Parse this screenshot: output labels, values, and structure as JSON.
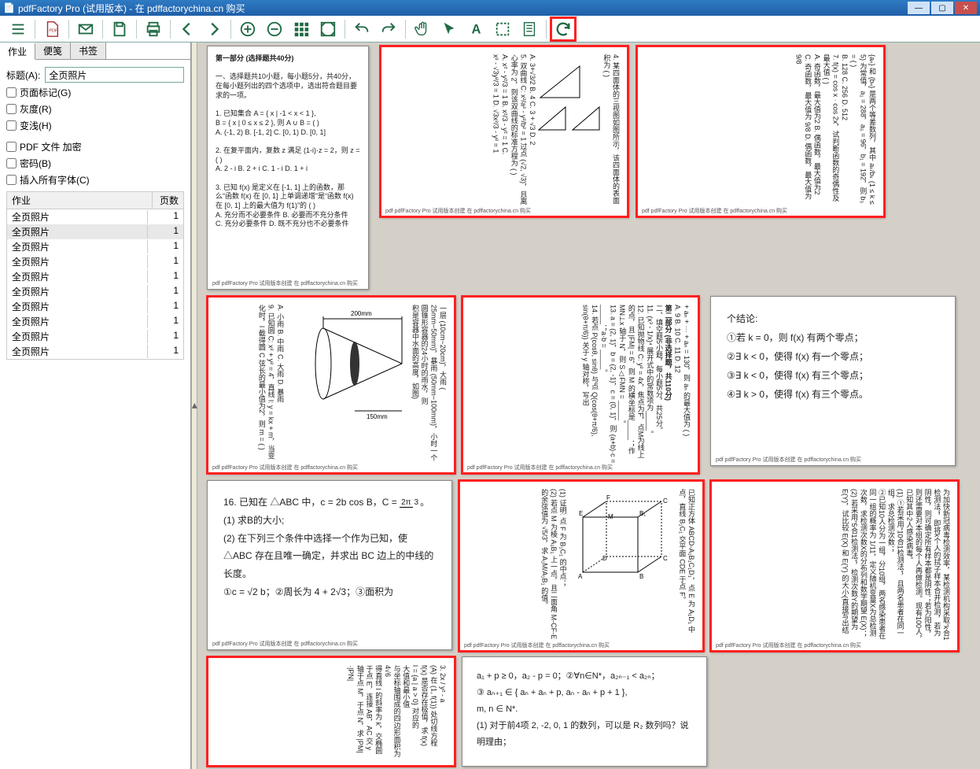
{
  "title": "pdfFactory Pro (试用版本) - 在 pdffactorychina.cn 购买",
  "tabs": {
    "jobs": "作业",
    "notes": "便笺",
    "bookmarks": "书签"
  },
  "sidebar": {
    "title_label": "标题(A):",
    "title_value": "全页照片",
    "opts": {
      "pagemark": "页面标记(G)",
      "gray": "灰度(R)",
      "light": "变浅(H)",
      "encrypt": "PDF 文件 加密",
      "pwd": "密码(B)",
      "embed": "插入所有字体(C)"
    },
    "list_hdr": {
      "name": "作业",
      "pages": "页数"
    },
    "items": [
      {
        "name": "全页照片",
        "pages": "1"
      },
      {
        "name": "全页照片",
        "pages": "1"
      },
      {
        "name": "全页照片",
        "pages": "1"
      },
      {
        "name": "全页照片",
        "pages": "1"
      },
      {
        "name": "全页照片",
        "pages": "1"
      },
      {
        "name": "全页照片",
        "pages": "1"
      },
      {
        "name": "全页照片",
        "pages": "1"
      },
      {
        "name": "全页照片",
        "pages": "1"
      },
      {
        "name": "全页照片",
        "pages": "1"
      },
      {
        "name": "全页照片",
        "pages": "1"
      }
    ]
  },
  "pages": {
    "p1": {
      "t1": "第一部分 (选择题共40分)",
      "t2": "一、选择题共10小题，每小题5分，共40分，在每小题列出的四个选项中，选出符合题目要求的一项。",
      "t3": "1. 已知集合 A = { x | -1 < x < 1 },",
      "t4": "B = { x | 0 ≤ x ≤ 2 }, 则 A ∪ B = (    )",
      "t5": "A. (-1, 2)   B. [-1, 2]   C. [0, 1)   D. [0, 1]",
      "t6": "2. 在复平面内，复数 z 满足 (1-i)·z = 2，则 z = (    )",
      "t7": "A. 2 - i   B. 2 + i   C. 1 - i   D. 1 + i",
      "t8": "3. 已知 f(x) 是定义在 [-1, 1] 上的函数，那么“函数 f(x) 在 [0, 1] 上单调递增”是“函数 f(x) 在 [0, 1] 上的最大值为 f(1)”的 (    )",
      "t9": "A. 充分而不必要条件   B. 必要而不充分条件",
      "t10": "C. 充分必要条件   D. 既不充分也不必要条件"
    },
    "p2": {
      "t1": "4. 某四面体的三视图如图所示，该四面体的表面积为 (    )",
      "t2": "A. 3+√3/2   B. 4   C. 3 + √3   D. 2",
      "t3": "5. 双曲线 C: x²/a² - y²/b² = 1 过点 (√2, √3)，且离心率为 2，则该双曲线的标准方程为 (    )",
      "t4": "A. x² - y²/3 = 1   B. x²/3 - y² = 1   C.",
      "t5": "x² - √3y²/3 = 1   D. √3x²/3 - y² = 1"
    },
    "p3": {
      "t1": "{aₙ} 和 {bₙ} 是两个等差数列，其中 aₖ/bₖ (1 ≤ k ≤ 5) 为常值，a₁ = 288，a₅ = 96，b₁ = 192，则 b₃ = (    )",
      "t2": "B. 128   C. 256   D. 512",
      "t3": "7. f(x) = cos x · cos 2x，试判断函数的奇偶性及最大值 (    )",
      "t4": "A. 奇函数，最大值为2   B. 偶函数，最大值为2",
      "t5": "C. 奇函数，最大值为 9/8   D. 偶函数，最大值为 9/8"
    },
    "p4": {
      "t1": "一层 (10cm~20cm)，大雨 (",
      "t2": "25mm~50mm)，暴雨 (50mm~100mm)，小时一个圆锥形容器的24小时的雨水，则",
      "t3": "积是容器中水面的高度，如图)",
      "t4": "A. 小雨   B. 中雨   C. 大雨   D. 暴雨",
      "t5": "9. 已知圆 C: x² + y² = 4，直线 l: y = kx + m，当变化时，l 截得圆 C 弦长的最小值为2，则 m = (    )"
    },
    "p5": {
      "t1": "+ aₙ + ··· + aₙ = 130，则 aₙ 的最大值为 (    )",
      "t2": "A. 9   B. 10   C. 11   D. 12",
      "t3": "第二部分 (非选择题，共110分)",
      "t4": "二、填空题5小题，每小题5分，共25分。",
      "t5": "11. (x³ - 1/x)⁴ 展开式中的常数项为_____。",
      "t6": "12. 已知抛物线 C: y² = 4x，焦点为F，点M为线上的点，且 |FM| = 6，则 M 的横坐标是_____；作 MN⊥x 轴于 N，则 S△FMN = _____。",
      "t7": "13. a = (2, 1)，b = (2, -1)，c = (0, 1)，则 (a+b)·c = _____；a·b = _____。",
      "t8": "14. 若点 P(cosθ, sinθ) 与点 Q(cos(θ+π/6), sin(θ+π/6)) 关于 y 轴对称，写出"
    },
    "p6": {
      "t1": "个结论:",
      "t2": "①若 k = 0，则 f(x) 有两个零点；",
      "t3": "②∃ k < 0，使得 f(x) 有一个零点；",
      "t4": "③∃ k < 0，使得 f(x) 有三个零点；",
      "t5": "④∃ k > 0，使得 f(x) 有三个零点。"
    },
    "p7": {
      "t1": "16. 已知在 △ABC 中，c = 2b cos B，C = ",
      "fr": {
        "n": "2π",
        "d": "3"
      },
      "t1b": "。",
      "t2": "(1) 求B的大小;",
      "t3": "(2) 在下列三个条件中选择一个作为已知，使 △ABC 存在且唯一确定，并求出 BC 边上的中线的长度。",
      "t4": "①c = √2 b；②周长为 4 + 2√3；③面积为"
    },
    "p8": {
      "t1": "已知正方体 ABCD-A₁B₁C₁D₁，点 E 为 A₁D₁ 中点，直线 B₁C₁ 交平面 CDE 于点 F。",
      "t2": "(1) 证明: 点 F 为 B₁C₁ 的中点；",
      "t3": "(2) 若点 M 为棱 A₁B₁ 上一点，且二面角 M-CF-E 的余弦值为 √5/3，求 A₁M/A₁B₁ 的值。"
    },
    "p9": {
      "t1": "为加快新冠病毒检测效率，某检测机构采取“k合1检测法”，即将k个人的拭子样本合并检测，若为阴性，则可确定所有样本都是阴性；若为阳性，则还需要对本组的每个人再做检测。现有100人，已知其中2人感染病毒。",
      "t2": "(1) ①若采用“10合1检测法”，且两名患者在同一组，求总检测次数；",
      "t3": "②已知10人分为一组，分10组，两名感染患者在同一组的概率为 1/11，定义随机变量X为总检测次数，求检测次数X的分布列和数学期望 E(X)；",
      "t4": "(2) 若采用“5合1检测法”，检测次数Y的期望为 E(Y)，试比较 E(X) 和 E(Y) 的大小(直接写出结"
    },
    "p10": {
      "t1": "3. 2x / y² - a",
      "t2": "(A) 在 (1, f(1)) 处切线方程",
      "t3": "f(x) 是否存在极值，求 f(x)",
      "t4": "l = {a | a > 0} 对应的",
      "t5": "大值和最小值",
      "t6": "与坐标轴围成的四边形面积为 4√6",
      "t7": "得直线 l 的斜率为 k，交椭圆于点 E，连接 AB，AC 交 y 轴于点 M，于点 N，求 |PM|·|PN|"
    },
    "p11": {
      "t1": "a₁ + p ≥ 0，a₂ - p = 0；②∀n∈N*，a₂ₙ₋₁ < a₂ₙ；",
      "t2": "③ aₙ₊₁ ∈ { aₙ + aₙ + p, aₙ - aₙ + p + 1 },",
      "t3": "m, n ∈ N*.",
      "t4": "(1) 对于前4项 2, -2, 0, 1 的数列，可以是 R₂ 数列吗？说明理由；"
    }
  },
  "footnote": "pdf pdfFactory Pro 试用版本创建 在 pdffactorychina.cn 购买"
}
